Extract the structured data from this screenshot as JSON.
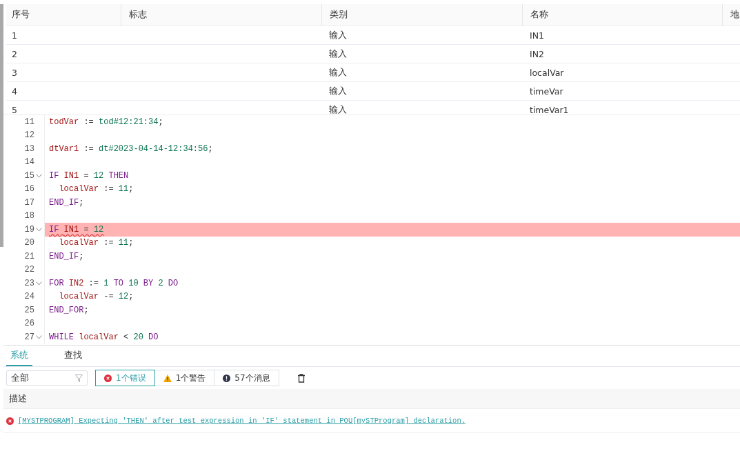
{
  "table": {
    "columns": [
      "序号",
      "标志",
      "类别",
      "名称",
      "地"
    ],
    "rows": [
      {
        "cells": [
          "1",
          "",
          "输入",
          "IN1"
        ]
      },
      {
        "cells": [
          "2",
          "",
          "输入",
          "IN2"
        ]
      },
      {
        "cells": [
          "3",
          "",
          "输入",
          "localVar"
        ]
      },
      {
        "cells": [
          "4",
          "",
          "输入",
          "timeVar"
        ]
      },
      {
        "cells": [
          "5",
          "",
          "输入",
          "timeVar1"
        ]
      }
    ]
  },
  "editor": {
    "lines": [
      {
        "number": "11",
        "foldable": false,
        "error": false,
        "tokens": [
          {
            "text": "todVar",
            "kind": "var"
          },
          {
            "text": " := ",
            "kind": "op"
          },
          {
            "text": "tod#12:21:34",
            "kind": "lit"
          },
          {
            "text": ";",
            "kind": "op"
          }
        ]
      },
      {
        "number": "12",
        "foldable": false,
        "error": false
      },
      {
        "number": "13",
        "foldable": false,
        "error": false,
        "tokens": [
          {
            "text": "dtVar1",
            "kind": "var"
          },
          {
            "text": " := ",
            "kind": "op"
          },
          {
            "text": "dt#2023-04-14-12:34:56",
            "kind": "lit"
          },
          {
            "text": ";",
            "kind": "op"
          }
        ]
      },
      {
        "number": "14",
        "foldable": false,
        "error": false
      },
      {
        "number": "15",
        "foldable": true,
        "error": false,
        "tokens": [
          {
            "text": "IF ",
            "kind": "kw"
          },
          {
            "text": "IN1",
            "kind": "var"
          },
          {
            "text": " = ",
            "kind": "op"
          },
          {
            "text": "12",
            "kind": "lit"
          },
          {
            "text": " THEN",
            "kind": "kw"
          }
        ]
      },
      {
        "number": "16",
        "foldable": false,
        "error": false,
        "tokens": [
          {
            "text": "  localVar",
            "kind": "var"
          },
          {
            "text": " := ",
            "kind": "op"
          },
          {
            "text": "11",
            "kind": "lit"
          },
          {
            "text": ";",
            "kind": "op"
          }
        ]
      },
      {
        "number": "17",
        "foldable": false,
        "error": false,
        "tokens": [
          {
            "text": "END_IF",
            "kind": "kw"
          },
          {
            "text": ";",
            "kind": "op"
          }
        ]
      },
      {
        "number": "18",
        "foldable": false,
        "error": false
      },
      {
        "number": "19",
        "foldable": true,
        "error": true,
        "tokens": [
          {
            "text": "IF ",
            "kind": "kw"
          },
          {
            "text": "IN1",
            "kind": "var"
          },
          {
            "text": " = ",
            "kind": "op"
          },
          {
            "text": "12",
            "kind": "lit"
          }
        ]
      },
      {
        "number": "20",
        "foldable": false,
        "error": false,
        "tokens": [
          {
            "text": "  localVar",
            "kind": "var"
          },
          {
            "text": " := ",
            "kind": "op"
          },
          {
            "text": "11",
            "kind": "lit"
          },
          {
            "text": ";",
            "kind": "op"
          }
        ]
      },
      {
        "number": "21",
        "foldable": false,
        "error": false,
        "tokens": [
          {
            "text": "END_IF",
            "kind": "kw"
          },
          {
            "text": ";",
            "kind": "op"
          }
        ]
      },
      {
        "number": "22",
        "foldable": false,
        "error": false
      },
      {
        "number": "23",
        "foldable": true,
        "error": false,
        "tokens": [
          {
            "text": "FOR ",
            "kind": "kw"
          },
          {
            "text": "IN2",
            "kind": "var"
          },
          {
            "text": " := ",
            "kind": "op"
          },
          {
            "text": "1",
            "kind": "lit"
          },
          {
            "text": " TO ",
            "kind": "kw"
          },
          {
            "text": "10",
            "kind": "lit"
          },
          {
            "text": " BY ",
            "kind": "kw"
          },
          {
            "text": "2",
            "kind": "lit"
          },
          {
            "text": " DO",
            "kind": "kw"
          }
        ]
      },
      {
        "number": "24",
        "foldable": false,
        "error": false,
        "tokens": [
          {
            "text": "  localVar",
            "kind": "var"
          },
          {
            "text": " -= ",
            "kind": "op"
          },
          {
            "text": "12",
            "kind": "lit"
          },
          {
            "text": ";",
            "kind": "op"
          }
        ]
      },
      {
        "number": "25",
        "foldable": false,
        "error": false,
        "tokens": [
          {
            "text": "END_FOR",
            "kind": "kw"
          },
          {
            "text": ";",
            "kind": "op"
          }
        ]
      },
      {
        "number": "26",
        "foldable": false,
        "error": false
      },
      {
        "number": "27",
        "foldable": true,
        "error": false,
        "tokens": [
          {
            "text": "WHILE ",
            "kind": "kw"
          },
          {
            "text": "localVar",
            "kind": "var"
          },
          {
            "text": " < ",
            "kind": "op"
          },
          {
            "text": "20",
            "kind": "lit"
          },
          {
            "text": " DO",
            "kind": "kw"
          }
        ]
      }
    ]
  },
  "output": {
    "tabs": [
      {
        "label": "系统",
        "selected": true
      },
      {
        "label": "查找",
        "selected": false
      }
    ],
    "filter": {
      "value": "全部"
    },
    "counters": [
      {
        "kind": "error",
        "label": "1个错误",
        "selected": true
      },
      {
        "kind": "warning",
        "label": "1个警告",
        "selected": false
      },
      {
        "kind": "info",
        "label": "57个消息",
        "selected": false
      }
    ],
    "columns": [
      "描述"
    ],
    "messages": [
      {
        "kind": "error",
        "text": "[MYSTPROGRAM] Expecting 'THEN' after test expression in 'IF' statement in POU[mySTProgram] declaration."
      }
    ]
  }
}
